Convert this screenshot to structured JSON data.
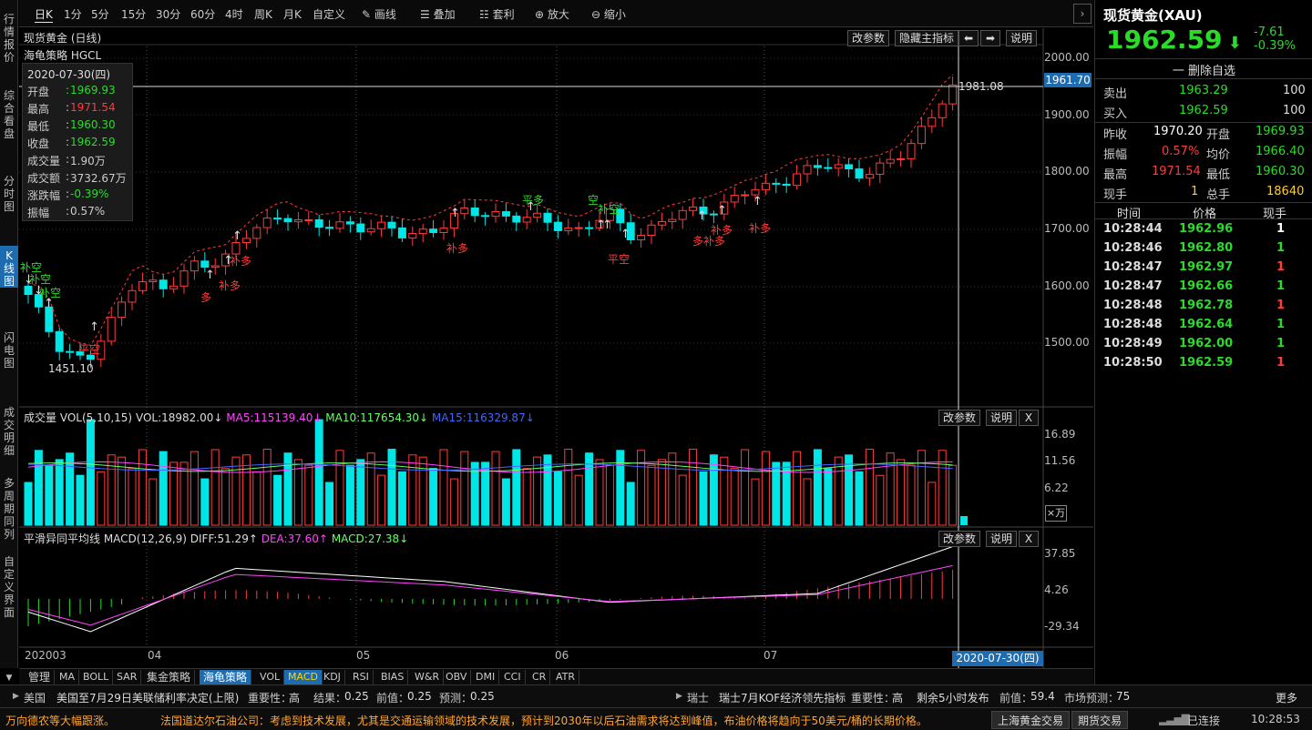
{
  "leftnav": [
    {
      "label": "行情报价",
      "active": false
    },
    {
      "label": "综合看盘",
      "active": false
    },
    {
      "label": "分时图",
      "active": false
    },
    {
      "label": "K线图",
      "active": true
    },
    {
      "label": "闪电图",
      "active": false
    },
    {
      "label": "成交明细",
      "active": false
    },
    {
      "label": "多周期同列",
      "active": false
    },
    {
      "label": "自定义界面",
      "active": false
    }
  ],
  "toolbar": {
    "periods": [
      "日K",
      "1分",
      "5分",
      "15分",
      "30分",
      "60分",
      "4时",
      "周K",
      "月K",
      "自定义"
    ],
    "selected": "日K",
    "tools": [
      "画线",
      "叠加",
      "套利",
      "放大",
      "缩小"
    ]
  },
  "chart": {
    "title": "现货黄金 (日线)",
    "strategy": "海龟策略 HGCL",
    "buttons": [
      "改参数",
      "隐藏主指标",
      "说明"
    ],
    "info": {
      "date": "2020-07-30(四)",
      "open_label": "开盘",
      "open": "1969.93",
      "high_label": "最高",
      "high": "1971.54",
      "low_label": "最低",
      "low": "1960.30",
      "close_label": "收盘",
      "close": "1962.59",
      "vol_label": "成交量",
      "vol": "1.90万",
      "amt_label": "成交额",
      "amt": "3732.67万",
      "chg_label": "涨跌幅",
      "chg": "-0.39%",
      "amp_label": "振幅",
      "amp": "0.57%"
    },
    "yaxis": [
      "2000.00",
      "1900.00",
      "1800.00",
      "1700.00",
      "1600.00",
      "1500.00"
    ],
    "current_price_tag": "1961.70",
    "max_label": "1981.08",
    "min_label": "1451.10",
    "signals": [
      "补空",
      "补空",
      "补空",
      "平空",
      "多",
      "补多",
      "补多",
      "补多",
      "平多",
      "空",
      "补空",
      "平空",
      "补多",
      "多补多",
      "补多"
    ]
  },
  "volume": {
    "title": "成交量 VOL(5,10,15)",
    "vol": "VOL:18982.00↓",
    "ma5": "MA5:115139.40↓",
    "ma10": "MA10:117654.30↓",
    "ma15": "MA15:116329.87↓",
    "yaxis": [
      "16.89",
      "11.56",
      "6.22"
    ],
    "unit": "×万",
    "buttons": [
      "改参数",
      "说明",
      "X"
    ]
  },
  "macd": {
    "title": "平滑异同平均线 MACD(12,26,9)",
    "diff": "DIFF:51.29↑",
    "dea": "DEA:37.60↑",
    "macd": "MACD:27.38↓",
    "yaxis": [
      "37.85",
      "4.26",
      "-29.34"
    ],
    "buttons": [
      "改参数",
      "说明",
      "X"
    ]
  },
  "xaxis": [
    "202003",
    "04",
    "05",
    "06",
    "07"
  ],
  "xaxis_current": "2020-07-30(四)",
  "bottom_tabs": [
    "管理",
    "MA",
    "BOLL",
    "SAR",
    "集金策略",
    "海龟策略",
    "VOL",
    "MACD",
    "KDJ",
    "RSI",
    "BIAS",
    "W&R",
    "OBV",
    "DMI",
    "CCI",
    "CR",
    "ATR"
  ],
  "quote": {
    "name": "现货黄金(XAU)",
    "price": "1962.59",
    "change": "-7.61",
    "change_pct": "-0.39%",
    "delete_label": "一 删除自选",
    "sell_label": "卖出",
    "sell": "1963.29",
    "sell_qty": "100",
    "buy_label": "买入",
    "buy": "1962.59",
    "buy_qty": "100",
    "prev_close_label": "昨收",
    "prev_close": "1970.20",
    "open_label": "开盘",
    "open": "1969.93",
    "amp_label": "振幅",
    "amp": "0.57%",
    "avg_label": "均价",
    "avg": "1966.40",
    "high_label": "最高",
    "high": "1971.54",
    "low_label": "最低",
    "low": "1960.30",
    "cur_hand_label": "现手",
    "cur_hand": "1",
    "total_hand_label": "总手",
    "total_hand": "18640",
    "trades_header": [
      "时间",
      "价格",
      "现手"
    ],
    "trades": [
      {
        "time": "10:28:44",
        "price": "1962.96",
        "qty": "1",
        "color": "#ffffff"
      },
      {
        "time": "10:28:46",
        "price": "1962.80",
        "qty": "1",
        "color": "#2adb2a"
      },
      {
        "time": "10:28:47",
        "price": "1962.97",
        "qty": "1",
        "color": "#ff3b3b"
      },
      {
        "time": "10:28:47",
        "price": "1962.66",
        "qty": "1",
        "color": "#2adb2a"
      },
      {
        "time": "10:28:48",
        "price": "1962.78",
        "qty": "1",
        "color": "#ff3b3b"
      },
      {
        "time": "10:28:48",
        "price": "1962.64",
        "qty": "1",
        "color": "#2adb2a"
      },
      {
        "time": "10:28:49",
        "price": "1962.00",
        "qty": "1",
        "color": "#2adb2a"
      },
      {
        "time": "10:28:50",
        "price": "1962.59",
        "qty": "1",
        "color": "#ff3b3b"
      }
    ]
  },
  "ticker1": {
    "region1": "美国",
    "event1": "美国至7月29日美联储利率决定(上限)",
    "imp_label1": "重要性：",
    "imp1": "高",
    "result_label": "结果：",
    "result": "0.25",
    "prev_label1": "前值：",
    "prev1": "0.25",
    "fore_label1": "预测：",
    "fore1": "0.25",
    "region2": "瑞士",
    "event2": "瑞士7月KOF经济领先指标",
    "imp_label2": "重要性：",
    "imp2": "高",
    "remain": "剩余5小时发布",
    "prev_label2": "前值：",
    "prev2": "59.4",
    "fore_label2": "市场预测：",
    "fore2": "75",
    "more": "更多"
  },
  "ticker2": {
    "news1": "万向德农等大幅跟涨。",
    "news2": "法国道达尔石油公司：考虑到技术发展，尤其是交通运输领域的技术发展，预计到2030年以后石油需求将达到峰值，布油价格将趋向于50美元/桶的长期价格。",
    "btn1": "上海黄金交易",
    "btn2": "期货交易",
    "status": "已连接",
    "time": "10:28:53"
  }
}
